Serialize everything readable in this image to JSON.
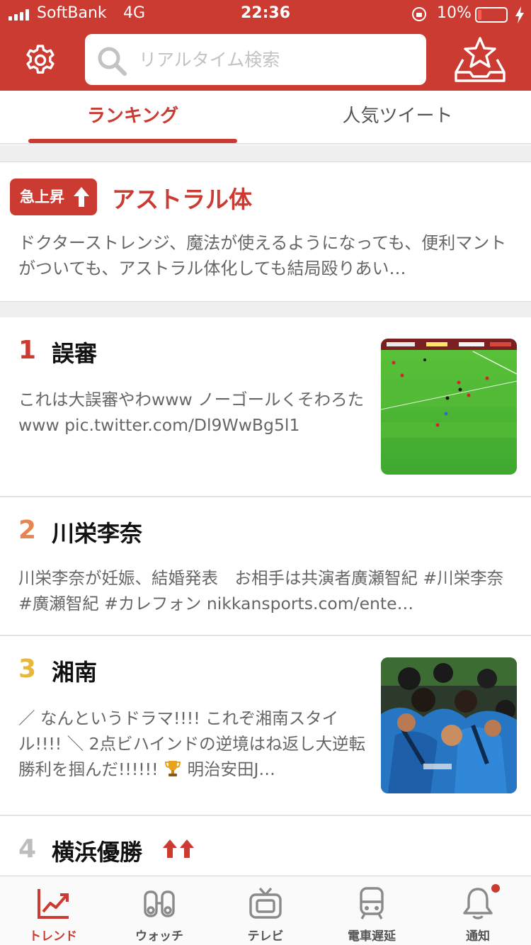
{
  "status_bar": {
    "carrier": "SoftBank",
    "network": "4G",
    "time": "22:36",
    "battery_percent": "10%",
    "battery_level": 0.1
  },
  "header": {
    "search_placeholder": "リアルタイム検索",
    "icons": [
      "gear-icon",
      "search-icon",
      "favorites-icon"
    ]
  },
  "tabs": [
    {
      "label": "ランキング",
      "active": true
    },
    {
      "label": "人気ツイート",
      "active": false
    }
  ],
  "featured": {
    "badge": "急上昇",
    "title": "アストラル体",
    "description": "ドクターストレンジ、魔法が使えるようになっても、便利マントがついても、アストラル体化しても結局殴りあい…"
  },
  "ranking": [
    {
      "rank": "1",
      "title": "誤審",
      "description": "これは大誤審やわwww ノーゴールくそわろたwww pic.twitter.com/Dl9WwBg5l1",
      "rank_color": "#cc3b32",
      "thumbnail": "soccer-match-image"
    },
    {
      "rank": "2",
      "title": "川栄李奈",
      "description": "川栄李奈が妊娠、結婚発表　お相手は共演者廣瀬智紀 #川栄李奈 #廣瀬智紀 #カレフォン nikkansports.com/ente…",
      "rank_color": "#e8854f"
    },
    {
      "rank": "3",
      "title": "湘南",
      "description_before": "／ なんというドラマ!!!! これぞ湘南スタイル!!!! ＼ 2点ビハインドの逆境はね返し大逆転勝利を掴んだ!!!!!! ",
      "description_after": " 明治安田J…",
      "rank_color": "#e9b83a",
      "thumbnail": "team-celebration-image",
      "emoji": "trophy-icon"
    },
    {
      "rank": "4",
      "title": "横浜優勝",
      "rank_color": "#bdbdbd",
      "trend": "rising-arrows-icon"
    }
  ],
  "bottom_nav": [
    {
      "label": "トレンド",
      "icon": "trend-chart-icon",
      "active": true
    },
    {
      "label": "ウォッチ",
      "icon": "binoculars-icon",
      "active": false
    },
    {
      "label": "テレビ",
      "icon": "tv-icon",
      "active": false
    },
    {
      "label": "電車遅延",
      "icon": "train-icon",
      "active": false
    },
    {
      "label": "通知",
      "icon": "bell-icon",
      "active": false,
      "badge_dot": true
    }
  ],
  "colors": {
    "accent": "#cc3b32",
    "rank2": "#e8854f",
    "rank3": "#e9b83a",
    "rank4": "#bdbdbd"
  }
}
